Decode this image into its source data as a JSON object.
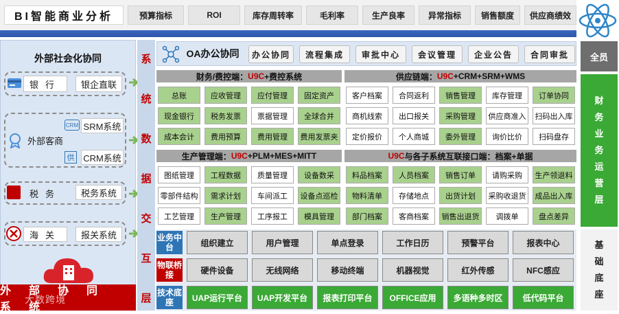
{
  "header": {
    "title": "BI智能商业分析",
    "kpis": [
      "预算指标",
      "ROI",
      "库存周转率",
      "毛利率",
      "生产良率",
      "异常指标",
      "销售额度",
      "供应商绩效"
    ]
  },
  "left": {
    "title": "外部社会化协同",
    "bank_label": "银行",
    "bank_box": "银企直联",
    "cust_label": "外部客商",
    "srm": "SRM系统",
    "crm": "CRM系统",
    "crm_icon_text": "CRM",
    "gong_icon_text": "供",
    "tax_label": "税务",
    "tax_box": "税务系统",
    "customs_label": "海关",
    "customs_box": "报关系统",
    "bottom_bar": "外部协同系统",
    "watermark": "大数跨境"
  },
  "vertical_label": [
    "系",
    "统",
    "数",
    "据",
    "交",
    "互",
    "层"
  ],
  "oa": {
    "title": "OA办公协同",
    "buttons": [
      "办公协同",
      "流程集成",
      "审批中心",
      "会议管理",
      "企业公告",
      "合同审批"
    ]
  },
  "finance": {
    "header_pre": "财务/费控端：",
    "header_red": "U9C",
    "header_post": "+费控系统",
    "cells": [
      [
        "总账",
        "应收管理",
        "应付管理",
        "固定资产"
      ],
      [
        "现金银行",
        "税务发票",
        "票据管理",
        "全球合并"
      ],
      [
        "成本会计",
        "费用预算",
        "费用管理",
        "费用发票夹"
      ]
    ]
  },
  "supply": {
    "header_pre": "供应链端：",
    "header_red": "U9C",
    "header_post": "+CRM+SRM+WMS",
    "cells": [
      [
        "客户档案",
        "合同返利",
        "销售管理",
        "库存管理",
        "订单协同"
      ],
      [
        "商机线索",
        "出口报关",
        "采购管理",
        "供应商准入",
        "扫码出入库"
      ],
      [
        "定价报价",
        "个人商城",
        "委外管理",
        "询价比价",
        "扫码盘存"
      ]
    ]
  },
  "production": {
    "header_pre": "生产管理端：",
    "header_red": "U9C",
    "header_post": "+PLM+MES+MITT",
    "cells": [
      [
        "图纸管理",
        "工程数据",
        "质量管理",
        "设备数采"
      ],
      [
        "零部件结构",
        "需求计划",
        "车间派工",
        "设备点巡检"
      ],
      [
        "工艺管理",
        "生产管理",
        "工序报工",
        "模具管理"
      ]
    ]
  },
  "interface": {
    "header_red": "U9C",
    "header_post": "与各子系统互联接口端：档案+单据",
    "cells": [
      [
        "料品档案",
        "人员档案",
        "销售订单",
        "请购采购",
        "生产领退料"
      ],
      [
        "物料清单",
        "存储地点",
        "出货计划",
        "采购收退货",
        "成品出入库"
      ],
      [
        "部门档案",
        "客商档案",
        "销售出退货",
        "调拨单",
        "盘点差异"
      ]
    ]
  },
  "platform_rows": [
    {
      "label": "业务中台",
      "items": [
        "组织建立",
        "用户管理",
        "单点登录",
        "工作日历",
        "预警平台",
        "报表中心"
      ]
    },
    {
      "label": "物联桥接",
      "items": [
        "硬件设备",
        "无线网络",
        "移动终端",
        "机器视觉",
        "红外传感",
        "NFC感应"
      ]
    },
    {
      "label": "技术底座",
      "items": [
        "UAP运行平台",
        "UAP开发平台",
        "报表打印平台",
        "OFFICE应用",
        "多语种多时区",
        "低代码平台"
      ]
    }
  ],
  "right_col": {
    "top": "全员",
    "business": "财务业务运营层",
    "base": "基础底座"
  },
  "colors": {
    "green_cell": "#a9d18e",
    "blue_label": "#2e75b6",
    "iot_label": "#c00000",
    "tech_label": "#2e75b6",
    "right_green": "#3aa935",
    "red_accent": "#c00000"
  }
}
